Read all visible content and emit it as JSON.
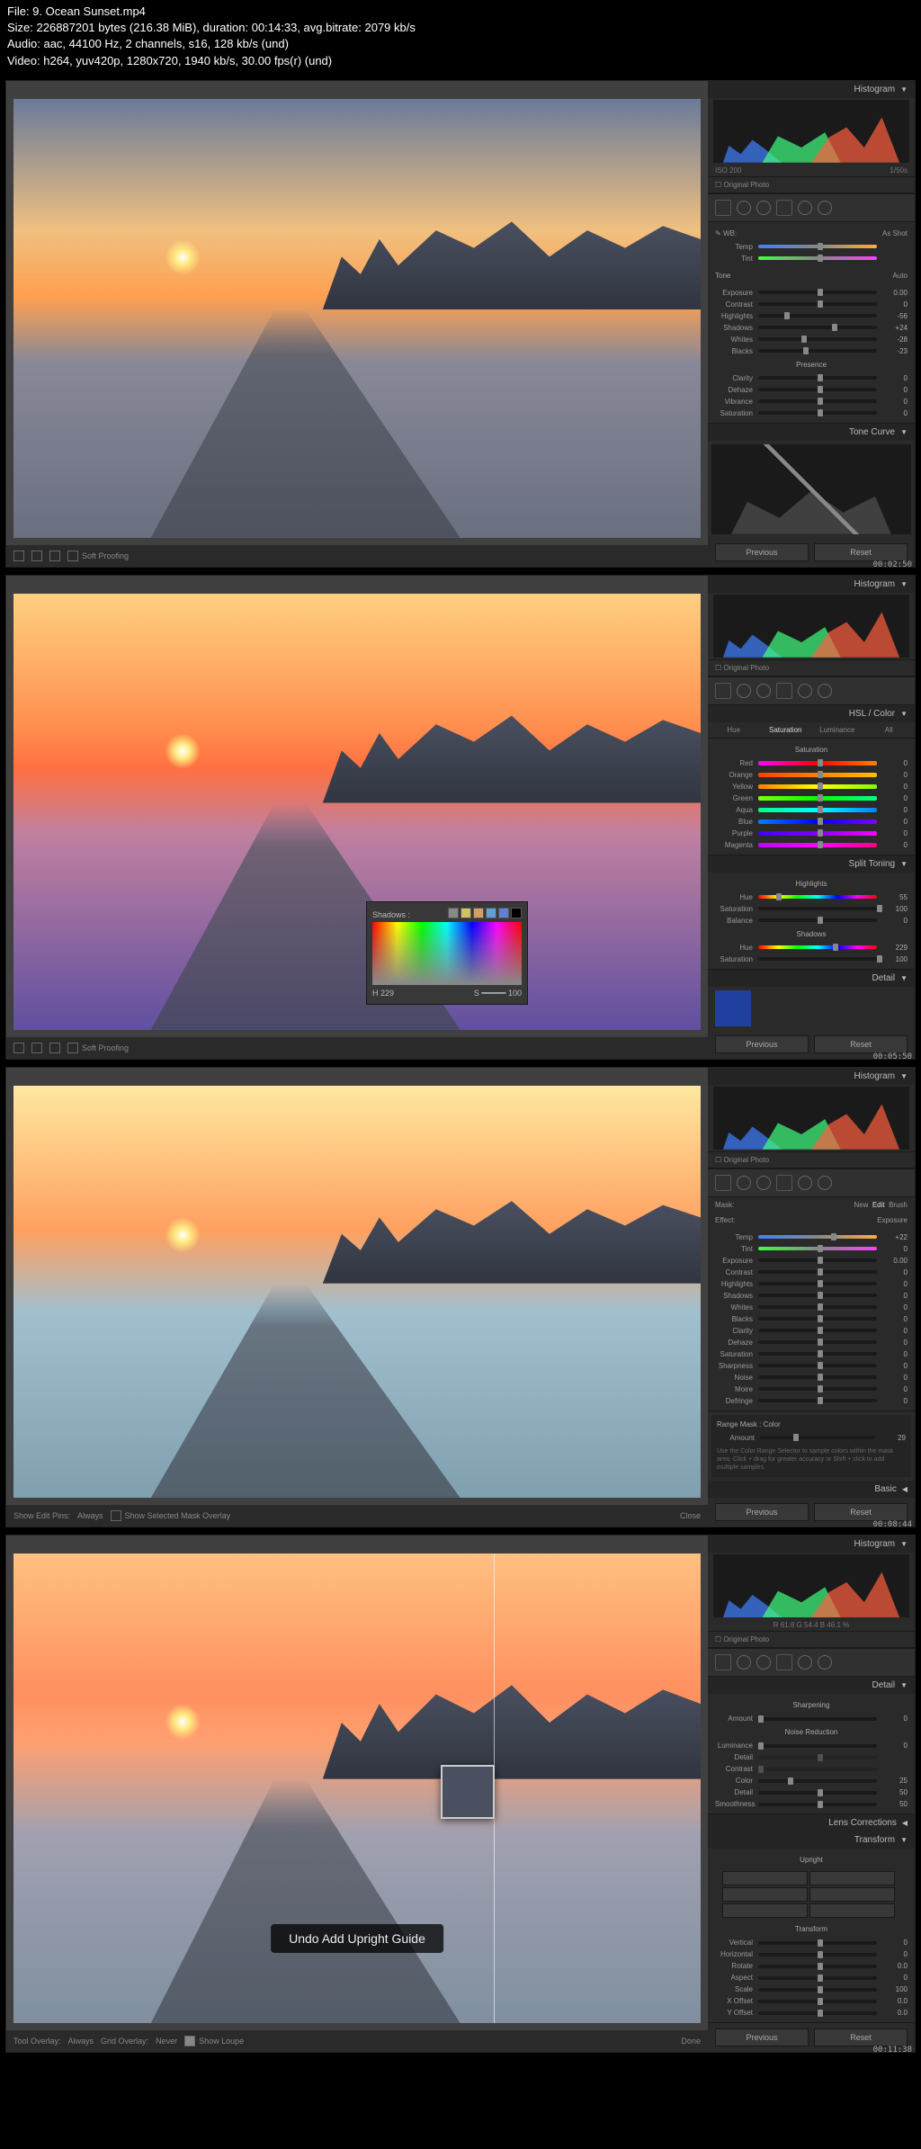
{
  "header": {
    "file_line": "File: 9. Ocean Sunset.mp4",
    "size_line": "Size: 226887201 bytes (216.38 MiB), duration: 00:14:33, avg.bitrate: 2079 kb/s",
    "audio_line": "Audio: aac, 44100 Hz, 2 channels, s16, 128 kb/s (und)",
    "video_line": "Video: h264, yuv420p, 1280x720, 1940 kb/s, 30.00 fps(r) (und)"
  },
  "shot1": {
    "timestamp": "00:02:50",
    "histogram_label": "Histogram",
    "hist_left": "ISO 200",
    "hist_right": "1/50s",
    "original_photo": "Original Photo",
    "soft_proofing": "Soft Proofing",
    "basic": {
      "wb_label": "WB:",
      "wb_value": "As Shot",
      "temp": {
        "label": "Temp",
        "value": ""
      },
      "tint": {
        "label": "Tint",
        "value": ""
      },
      "tone_heading": "Tone",
      "auto": "Auto",
      "exposure": {
        "label": "Exposure",
        "value": "0.00"
      },
      "contrast": {
        "label": "Contrast",
        "value": "0"
      },
      "highlights": {
        "label": "Highlights",
        "value": "-56"
      },
      "shadows": {
        "label": "Shadows",
        "value": "+24"
      },
      "whites": {
        "label": "Whites",
        "value": "-28"
      },
      "blacks": {
        "label": "Blacks",
        "value": "-23"
      },
      "presence_heading": "Presence",
      "clarity": {
        "label": "Clarity",
        "value": "0"
      },
      "dehaze": {
        "label": "Dehaze",
        "value": "0"
      },
      "vibrance": {
        "label": "Vibrance",
        "value": "0"
      },
      "saturation": {
        "label": "Saturation",
        "value": "0"
      }
    },
    "tone_curve_label": "Tone Curve",
    "previous": "Previous",
    "reset": "Reset"
  },
  "shot2": {
    "timestamp": "00:05:50",
    "histogram_label": "Histogram",
    "original_photo": "Original Photo",
    "soft_proofing": "Soft Proofing",
    "hsl_label": "HSL / Color",
    "hsl_tabs": {
      "hue": "Hue",
      "saturation": "Saturation",
      "luminance": "Luminance",
      "all": "All"
    },
    "hsl_heading": "Saturation",
    "colors": {
      "red": {
        "label": "Red",
        "value": "0"
      },
      "orange": {
        "label": "Orange",
        "value": "0"
      },
      "yellow": {
        "label": "Yellow",
        "value": "0"
      },
      "green": {
        "label": "Green",
        "value": "0"
      },
      "aqua": {
        "label": "Aqua",
        "value": "0"
      },
      "blue": {
        "label": "Blue",
        "value": "0"
      },
      "purple": {
        "label": "Purple",
        "value": "0"
      },
      "magenta": {
        "label": "Magenta",
        "value": "0"
      }
    },
    "split_toning_label": "Split Toning",
    "split": {
      "highlights": "Highlights",
      "hue_h": {
        "label": "Hue",
        "value": "55"
      },
      "sat_h": {
        "label": "Saturation",
        "value": "100"
      },
      "balance": {
        "label": "Balance",
        "value": "0"
      },
      "shadows": "Shadows",
      "hue_s": {
        "label": "Hue",
        "value": "229"
      },
      "sat_s": {
        "label": "Saturation",
        "value": "100"
      }
    },
    "picker": {
      "title": "Shadows :",
      "h_label": "H",
      "h_value": "229",
      "s_label": "S",
      "s_value": "100"
    },
    "detail_label": "Detail",
    "previous": "Previous",
    "reset": "Reset"
  },
  "shot3": {
    "timestamp": "00:08:44",
    "histogram_label": "Histogram",
    "original_photo": "Original Photo",
    "mask": {
      "label": "Mask:",
      "new": "New",
      "edit": "Edit",
      "brush": "Brush"
    },
    "effect": {
      "label": "Effect:",
      "value": "Exposure"
    },
    "sliders": {
      "temp": {
        "label": "Temp",
        "value": "+22"
      },
      "tint": {
        "label": "Tint",
        "value": "0"
      },
      "exposure": {
        "label": "Exposure",
        "value": "0.00"
      },
      "contrast": {
        "label": "Contrast",
        "value": "0"
      },
      "highlights": {
        "label": "Highlights",
        "value": "0"
      },
      "shadows": {
        "label": "Shadows",
        "value": "0"
      },
      "whites": {
        "label": "Whites",
        "value": "0"
      },
      "blacks": {
        "label": "Blacks",
        "value": "0"
      },
      "clarity": {
        "label": "Clarity",
        "value": "0"
      },
      "dehaze": {
        "label": "Dehaze",
        "value": "0"
      },
      "saturation": {
        "label": "Saturation",
        "value": "0"
      },
      "sharpness": {
        "label": "Sharpness",
        "value": "0"
      },
      "noise": {
        "label": "Noise",
        "value": "0"
      },
      "moire": {
        "label": "Moire",
        "value": "0"
      },
      "defringe": {
        "label": "Defringe",
        "value": "0"
      }
    },
    "range_mask": {
      "title": "Range Mask : Color",
      "amount": {
        "label": "Amount",
        "value": "29"
      },
      "hint": "Use the Color Range Selector to sample colors within the mask area. Click + drag for greater accuracy or Shift + click to add multiple samples."
    },
    "basic_label": "Basic",
    "bottom": {
      "show_pins": "Show Edit Pins:",
      "always": "Always",
      "show_overlay": "Show Selected Mask Overlay"
    },
    "previous": "Previous",
    "reset": "Reset",
    "close": "Close"
  },
  "shot4": {
    "timestamp": "00:11:38",
    "histogram_label": "Histogram",
    "hist_info": "R 61.8   G 54.4   B 46.1 %",
    "original_photo": "Original Photo",
    "detail_label": "Detail",
    "sharpening": "Sharpening",
    "amount": {
      "label": "Amount",
      "value": "0"
    },
    "noise_reduction": "Noise Reduction",
    "nr": {
      "luminance": {
        "label": "Luminance",
        "value": "0"
      },
      "detail": {
        "label": "Detail",
        "value": ""
      },
      "contrast": {
        "label": "Contrast",
        "value": ""
      },
      "color": {
        "label": "Color",
        "value": "25"
      },
      "color_detail": {
        "label": "Detail",
        "value": "50"
      },
      "smoothness": {
        "label": "Smoothness",
        "value": "50"
      }
    },
    "lens_label": "Lens Corrections",
    "transform_label": "Transform",
    "upright": "Upright",
    "transform_heading": "Transform",
    "transform": {
      "vertical": {
        "label": "Vertical",
        "value": "0"
      },
      "horizontal": {
        "label": "Horizontal",
        "value": "0"
      },
      "rotate": {
        "label": "Rotate",
        "value": "0.0"
      },
      "aspect": {
        "label": "Aspect",
        "value": "0"
      },
      "scale": {
        "label": "Scale",
        "value": "100"
      },
      "xoffset": {
        "label": "X Offset",
        "value": "0.0"
      },
      "yoffset": {
        "label": "Y Offset",
        "value": "0.0"
      }
    },
    "undo_msg": "Undo Add Upright Guide",
    "bottom": {
      "tool_overlay": "Tool Overlay:",
      "always": "Always",
      "grid_overlay": "Grid Overlay:",
      "never": "Never",
      "show_loupe": "Show Loupe"
    },
    "previous": "Previous",
    "reset": "Reset",
    "done": "Done"
  }
}
